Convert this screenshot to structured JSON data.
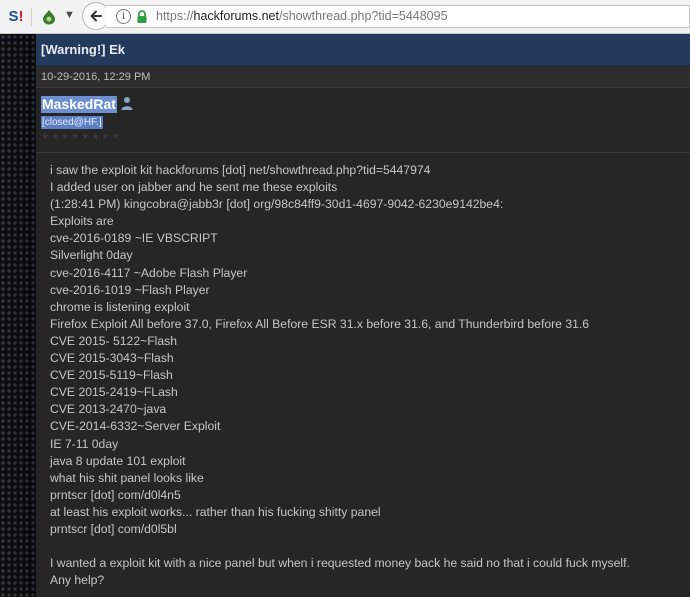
{
  "browser": {
    "url_prefix": "https://",
    "url_host": "hackforums.net",
    "url_path": "/showthread.php?tid=5448095"
  },
  "post": {
    "title": "[Warning!] Ek",
    "date": "10-29-2016, 12:29 PM",
    "author": {
      "username": "MaskedRat",
      "usertitle": "[closed@HF.]",
      "stars": "★★★★★★★★"
    },
    "lines": [
      "i saw the exploit kit hackforums [dot] net/showthread.php?tid=5447974",
      "I added user on jabber and he sent me these exploits",
      "(1:28:41 PM) kingcobra@jabb3r [dot] org/98c84ff9-30d1-4697-9042-6230e9142be4:",
      "Exploits are",
      "cve-2016-0189 ~IE VBSCRIPT",
      "Silverlight 0day",
      "cve-2016-4117 ~Adobe Flash Player",
      "cve-2016-1019 ~Flash Player",
      "chrome is listening exploit",
      "Firefox Exploit All before 37.0, Firefox All Before ESR 31.x before 31.6, and Thunderbird before 31.6",
      "CVE 2015- 5122~Flash",
      "CVE 2015-3043~Flash",
      "CVE 2015-5119~Flash",
      "CVE 2015-2419~FLash",
      "CVE 2013-2470~java",
      "CVE-2014-6332~Server Exploit",
      "IE 7-11 0day",
      "java 8 update 101 exploit",
      "what his shit panel looks like",
      "prntscr [dot] com/d0l4n5",
      "at least his exploit works... rather than his fucking shitty panel",
      "prntscr [dot] com/d0l5bl",
      "",
      "I wanted a exploit kit with a nice panel but when i requested money back he said no that i could fuck myself.",
      "Any help?"
    ]
  }
}
